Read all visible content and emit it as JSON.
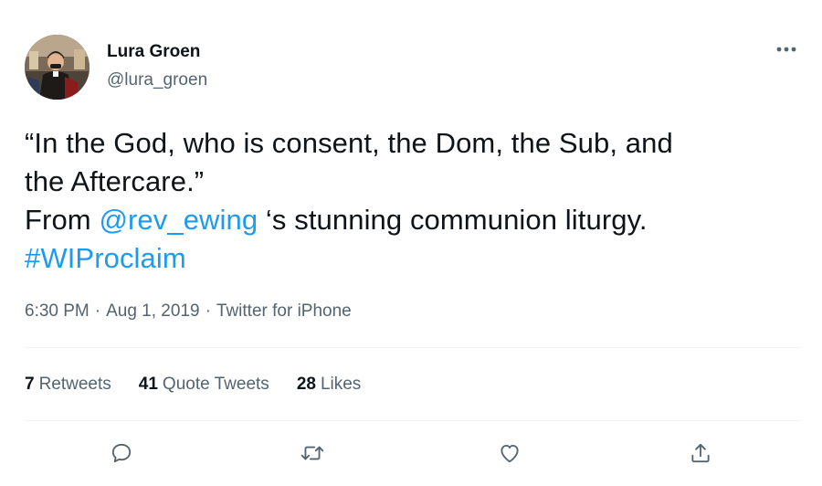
{
  "author": {
    "display_name": "Lura Groen",
    "handle": "@lura_groen"
  },
  "tweet": {
    "line1": "“In the God, who is consent, the Dom, the Sub, and",
    "line2": "the Aftercare.”",
    "line3_prefix": "From ",
    "mention": "@rev_ewing",
    "line3_suffix": " ‘s stunning communion liturgy.",
    "hashtag": "#WIProclaim"
  },
  "meta": {
    "time": "6:30 PM",
    "separator": "·",
    "date": "Aug 1, 2019",
    "source": "Twitter for iPhone"
  },
  "stats": {
    "retweets_count": "7",
    "retweets_label": "Retweets",
    "quotes_count": "41",
    "quotes_label": "Quote Tweets",
    "likes_count": "28",
    "likes_label": "Likes"
  },
  "icons": {
    "more": "more-horizontal-icon",
    "reply": "reply-icon",
    "retweet": "retweet-icon",
    "like": "heart-icon",
    "share": "share-icon"
  },
  "colors": {
    "accent": "#1d9bf0",
    "text_primary": "#0f1419",
    "text_secondary": "#536471",
    "divider": "#eff3f4"
  }
}
